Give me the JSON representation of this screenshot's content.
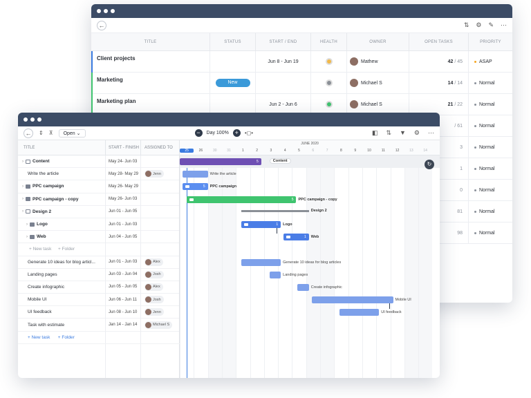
{
  "back": {
    "columns": [
      "TITLE",
      "STATUS",
      "START / END",
      "HEALTH",
      "OWNER",
      "OPEN TASKS",
      "PRIORITY"
    ],
    "rows": [
      {
        "title": "Client projects",
        "status": "",
        "dates": "Jun 8 - Jun 19",
        "health": "#f2b94a",
        "owner": "Mathew",
        "open": "42",
        "total": "/ 45",
        "priority": "ASAP",
        "prio_color": "#f5a623",
        "accent": "#3a7be0"
      },
      {
        "title": "Marketing",
        "status": "New",
        "dates": "",
        "health": "#8a8f96",
        "owner": "Michael S",
        "open": "14",
        "total": "/ 14",
        "priority": "Normal",
        "prio_color": "#8a909a",
        "accent": "#3fc46f"
      },
      {
        "title": "Marketing plan",
        "status": "",
        "dates": "Jun 2 - Jun 6",
        "health": "#3fc46f",
        "owner": "Michael S",
        "open": "21",
        "total": "/ 22",
        "priority": "Normal",
        "prio_color": "#8a909a",
        "accent": "#3fc46f"
      },
      {
        "open": "",
        "total": "/ 61",
        "priority": "Normal"
      },
      {
        "open": "",
        "total": "3",
        "priority": "Normal"
      },
      {
        "open": "",
        "total": "1",
        "priority": "Normal"
      },
      {
        "open": "",
        "total": "0",
        "priority": "Normal"
      },
      {
        "open": "",
        "total": "81",
        "priority": "Normal"
      },
      {
        "open": "",
        "total": "98",
        "priority": "Normal"
      }
    ]
  },
  "front": {
    "toolbar": {
      "open_label": "Open",
      "zoom_label": "Day 100%"
    },
    "columns": {
      "title": "TITLE",
      "dates": "START - FINISH",
      "assigned": "ASSIGNED TO"
    },
    "rows": [
      {
        "title": "Content",
        "dates": "May 24- Jun 03",
        "assignee": "",
        "kind": "group"
      },
      {
        "title": "Write the article",
        "dates": "May 28- May 29",
        "assignee": "Jenn",
        "kind": "task"
      },
      {
        "title": "PPC campaign",
        "dates": "May 26- May 29",
        "assignee": "",
        "kind": "folder"
      },
      {
        "title": "PPC campaign - copy",
        "dates": "May 26- Jun 03",
        "assignee": "",
        "kind": "folder"
      },
      {
        "title": "Design 2",
        "dates": "Jun 01 - Jun 05",
        "assignee": "",
        "kind": "group"
      },
      {
        "title": "Logo",
        "dates": "Jun 01 - Jun 03",
        "assignee": "",
        "kind": "subfolder"
      },
      {
        "title": "Web",
        "dates": "Jun 04 - Jun 05",
        "assignee": "",
        "kind": "subfolder"
      },
      {
        "title": "",
        "dates": "",
        "assignee": "",
        "kind": "add"
      },
      {
        "title": "Generate 10 ideas for blog articl...",
        "dates": "Jun 01 - Jun 03",
        "assignee": "Alex",
        "kind": "task"
      },
      {
        "title": "Landing pages",
        "dates": "Jun 03 - Jun 04",
        "assignee": "Josh",
        "kind": "task"
      },
      {
        "title": "Create infographic",
        "dates": "Jun 05 - Jun 05",
        "assignee": "Alex",
        "kind": "task"
      },
      {
        "title": "Mobile UI",
        "dates": "Jun 06 - Jun 11",
        "assignee": "Josh",
        "kind": "task"
      },
      {
        "title": "UI feedback",
        "dates": "Jun 08 - Jun 10",
        "assignee": "Jenn",
        "kind": "task"
      },
      {
        "title": "Task with estimate",
        "dates": "Jan 14 - Jan 14",
        "assignee": "Michael S",
        "kind": "task"
      }
    ],
    "add_task": "+ New task",
    "add_folder": "+ Folder",
    "month_label": "JUNE 2020",
    "days": [
      "25",
      "26",
      "30",
      "31",
      "1",
      "2",
      "3",
      "4",
      "5",
      "6",
      "7",
      "8",
      "9",
      "10",
      "11",
      "12",
      "13",
      "14"
    ],
    "bars": [
      {
        "label": "Content",
        "start": -1,
        "span": 7,
        "row": 0,
        "color": "#6e4fb3",
        "type": "group",
        "badge": "5"
      },
      {
        "label": "Write the article",
        "start": 0,
        "span": 2,
        "row": 1,
        "color": "#7da0ea",
        "type": "task"
      },
      {
        "label": "PPC campaign",
        "start": 0,
        "span": 2,
        "row": 2,
        "color": "#5b8ef0",
        "type": "folder",
        "badge": "5"
      },
      {
        "label": "PPC campaign - copy",
        "start": 0.3,
        "span": 8,
        "row": 3,
        "color": "#3fc46f",
        "type": "folder",
        "badge": "5"
      },
      {
        "label": "Design 2",
        "start": 4.2,
        "span": 5,
        "row": 4,
        "color": "#8a8f96",
        "type": "summary"
      },
      {
        "label": "Logo",
        "start": 4.2,
        "span": 3,
        "row": 5,
        "color": "#4a7de6",
        "type": "folder",
        "badge": "1"
      },
      {
        "label": "Web",
        "start": 7.2,
        "span": 2,
        "row": 6,
        "color": "#4a7de6",
        "type": "folder",
        "badge": "1"
      },
      {
        "label": "Generate 10 ideas for blog articles",
        "start": 4.2,
        "span": 3,
        "row": 8,
        "color": "#7da0ea",
        "type": "task"
      },
      {
        "label": "Landing pages",
        "start": 6.2,
        "span": 1,
        "row": 9,
        "color": "#7da0ea",
        "type": "task"
      },
      {
        "label": "Create infographic",
        "start": 8.2,
        "span": 1,
        "row": 10,
        "color": "#7da0ea",
        "type": "task"
      },
      {
        "label": "Mobile UI",
        "start": 9.2,
        "span": 6,
        "row": 11,
        "color": "#7da0ea",
        "type": "task"
      },
      {
        "label": "UI feedback",
        "start": 11.2,
        "span": 3,
        "row": 12,
        "color": "#7da0ea",
        "type": "task"
      }
    ]
  }
}
